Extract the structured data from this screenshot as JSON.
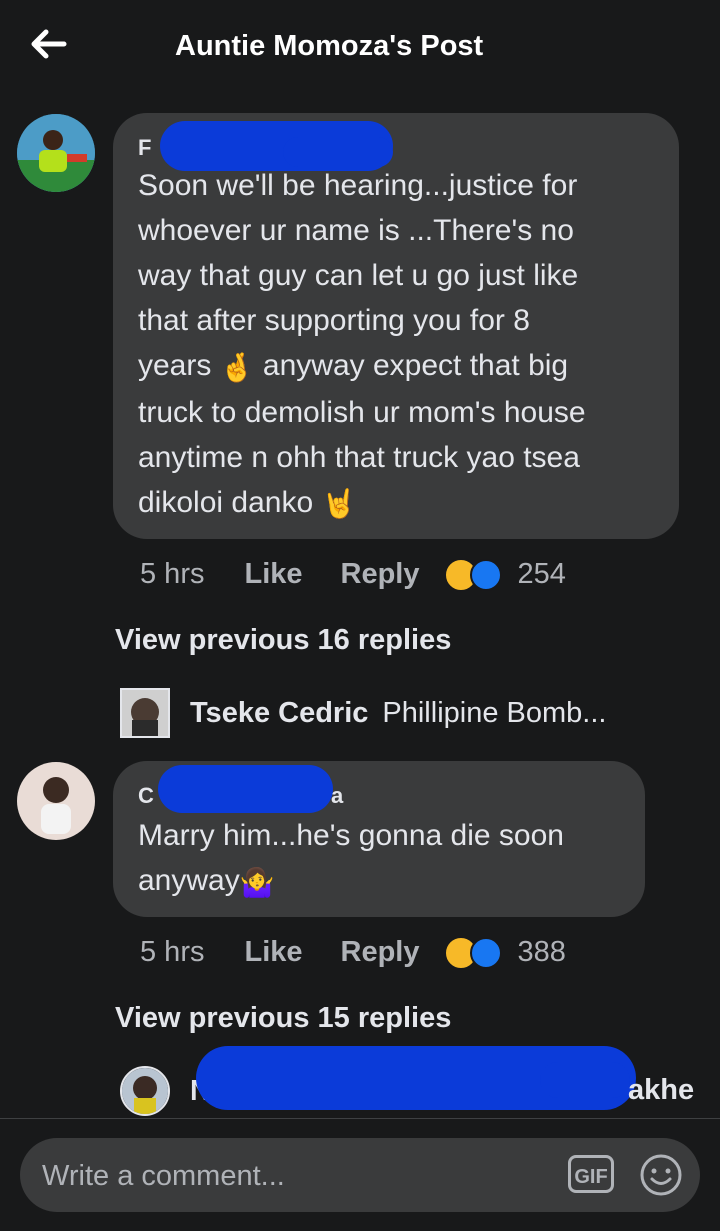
{
  "header": {
    "title": "Auntie Momoza's Post",
    "back_icon": "arrow-left-icon"
  },
  "comments": [
    {
      "name_visible": "F",
      "name_trailing": "",
      "text_lines": [
        "Soon we'll be hearing...justice for",
        "whoever ur name is ...There's no",
        "way that guy can let u go just like",
        "that after supporting you for 8"
      ],
      "line5_a": "years",
      "emoji_crossed": "🤞",
      "line5_b": "anyway expect that big",
      "text_lines_2": [
        "truck to demolish ur mom's house",
        "anytime n ohh that truck yao tsea"
      ],
      "line8": "dikoloi danko",
      "emoji_horns": "🤘",
      "time": "5 hrs",
      "like_label": "Like",
      "reply_label": "Reply",
      "reaction_count": "254"
    },
    {
      "name_visible": "C",
      "name_trailing": "a",
      "text_line1": "Marry him...he's gonna die soon",
      "text_line2": "anyway",
      "emoji_shrug": "🤷‍♀️",
      "time": "5 hrs",
      "like_label": "Like",
      "reply_label": "Reply",
      "reaction_count": "388"
    }
  ],
  "view_previous": [
    "View previous 16 replies",
    "View previous 15 replies"
  ],
  "reply_preview_1": {
    "name": "Tseke Cedric",
    "snippet": "Phillipine Bomb..."
  },
  "reply_preview_2": {
    "name_start": "N",
    "name_end": "akhe"
  },
  "composer": {
    "placeholder": "Write a comment...",
    "gif_label": "GIF"
  },
  "colors": {
    "background": "#18191a",
    "bubble": "#3a3b3c",
    "text": "#e4e6eb",
    "muted": "#b0b3b8",
    "redaction": "#0b3bd9",
    "like_blue": "#1877f2",
    "haha_yellow": "#f7b928"
  }
}
